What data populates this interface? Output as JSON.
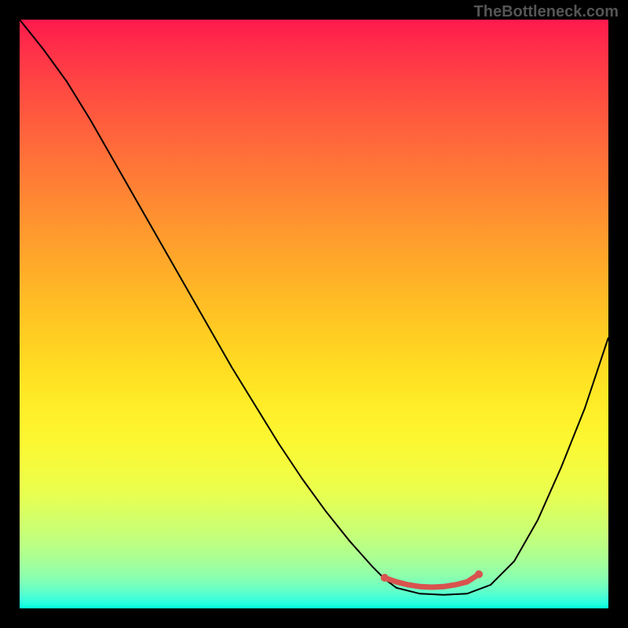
{
  "watermark": "TheBottleneck.com",
  "chart_data": {
    "type": "line",
    "title": "",
    "xlabel": "",
    "ylabel": "",
    "xlim": [
      0,
      100
    ],
    "ylim": [
      0,
      100
    ],
    "series": [
      {
        "name": "bottleneck-curve",
        "color": "#000000",
        "x": [
          0,
          4,
          8,
          12,
          16,
          20,
          24,
          28,
          32,
          36,
          40,
          44,
          48,
          52,
          56,
          60,
          62,
          64,
          68,
          72,
          76,
          80,
          84,
          88,
          92,
          96,
          100
        ],
        "y": [
          100,
          95,
          89.5,
          83,
          76,
          69,
          62,
          55,
          48,
          41,
          34.5,
          28,
          22,
          16.5,
          11.5,
          7,
          5,
          3.5,
          2.5,
          2.3,
          2.5,
          4,
          8,
          15,
          24,
          34,
          46
        ]
      },
      {
        "name": "optimal-range-marker",
        "color": "#d9534f",
        "x": [
          62,
          64,
          66,
          68,
          70,
          72,
          74,
          76,
          78
        ],
        "y": [
          5.2,
          4.5,
          4.0,
          3.7,
          3.6,
          3.7,
          4.0,
          4.5,
          5.8
        ]
      }
    ],
    "marker_endpoints": {
      "left": {
        "x": 62,
        "y": 5.2
      },
      "right": {
        "x": 78,
        "y": 5.8
      }
    }
  }
}
